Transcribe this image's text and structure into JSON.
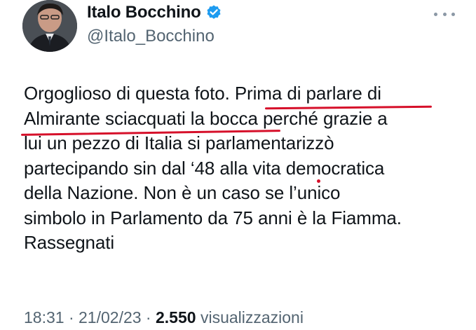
{
  "author": {
    "display_name": "Italo Bocchino",
    "handle": "@Italo_Bocchino",
    "verified": true
  },
  "tweet": {
    "lines": [
      "Orgoglioso di questa foto. Prima di parlare di",
      "Almirante sciacquati la bocca perché grazie a",
      "lui un pezzo di Italia si parlamentarizzò",
      "partecipando sin dal ‘48 alla vita democratica",
      "della Nazione. Non è un caso se l’unico",
      "simbolo in Parlamento da 75 anni è la Fiamma.",
      "Rassegnati"
    ]
  },
  "meta": {
    "time": "18:31",
    "separator": " · ",
    "date": "21/02/23",
    "separator2": " · ",
    "views_count": "2.550",
    "views_label": " visualizzazioni"
  },
  "colors": {
    "verified": "#1d9bf0",
    "annotation_red": "#d6102a",
    "secondary_text": "#536471"
  },
  "icons": {
    "verified": "verified-badge-icon",
    "more": "more-options-icon"
  }
}
